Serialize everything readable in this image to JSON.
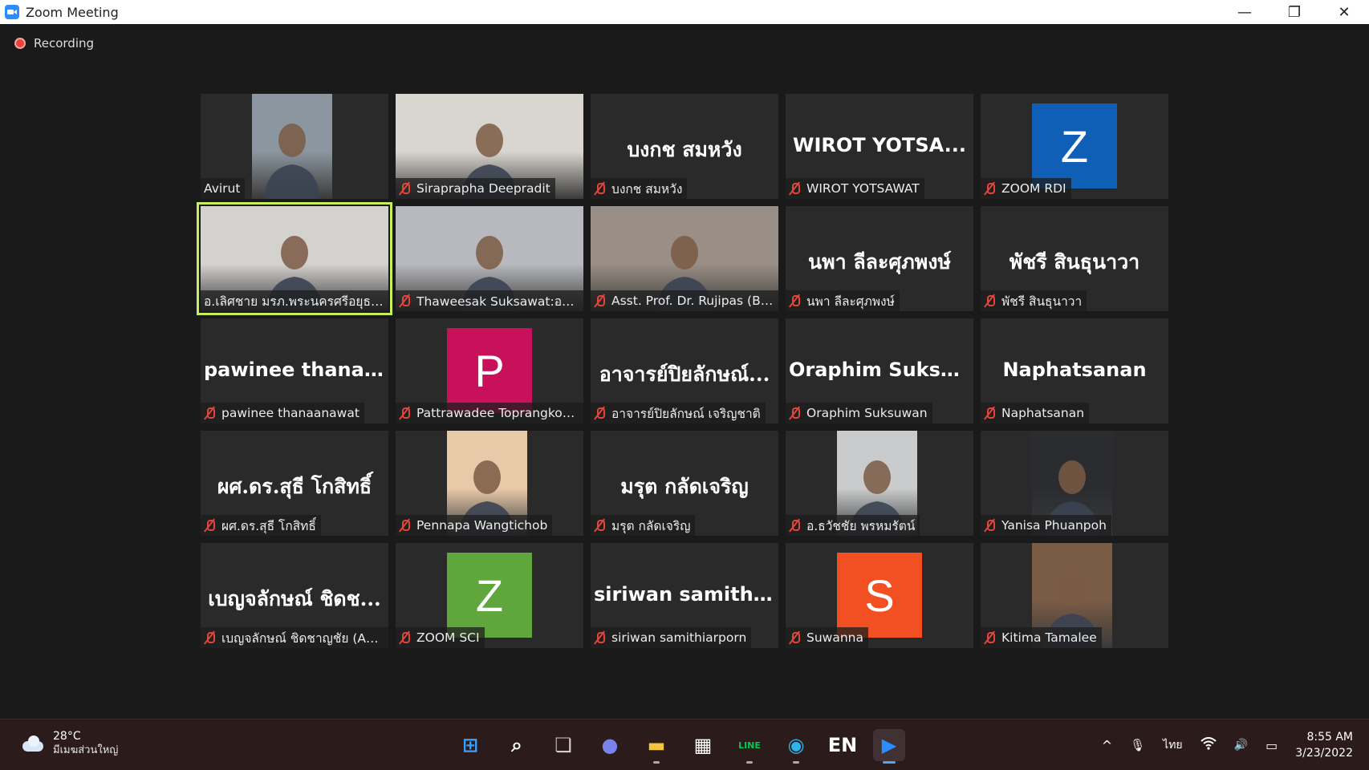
{
  "window": {
    "title": "Zoom Meeting",
    "minimize": "—",
    "restore": "❐",
    "close": "✕"
  },
  "meeting": {
    "recording_label": "Recording"
  },
  "participants": [
    {
      "row": 0,
      "col": 0,
      "label": "Avirut",
      "muted": false,
      "kind": "video",
      "bg": "#8c96a0"
    },
    {
      "row": 0,
      "col": 1,
      "label": "Siraprapha Deepradit",
      "muted": true,
      "kind": "video-wide",
      "bg": "#d9d6cf"
    },
    {
      "row": 0,
      "col": 2,
      "label": "บงกช สมหวัง",
      "display": "บงกช สมหวัง",
      "muted": true,
      "kind": "name"
    },
    {
      "row": 0,
      "col": 3,
      "label": "WIROT YOTSAWAT",
      "display": "WIROT  YOTSA...",
      "muted": true,
      "kind": "name",
      "latin": true
    },
    {
      "row": 0,
      "col": 4,
      "label": "ZOOM RDI",
      "avatar_letter": "Z",
      "avatar_color": "#0e5fb5",
      "muted": true,
      "kind": "avatar"
    },
    {
      "row": 1,
      "col": 0,
      "label": "อ.เลิศชาย มรภ.พระนครศรีอยุธยา",
      "muted": false,
      "kind": "video-wide",
      "bg": "#d4d2cf",
      "active": true
    },
    {
      "row": 1,
      "col": 1,
      "label": "Thaweesak Suksawat:อนุฯ ...",
      "muted": true,
      "kind": "video-wide",
      "bg": "#b8b9be"
    },
    {
      "row": 1,
      "col": 2,
      "label": "Asst. Prof. Dr. Rujipas (Bai...",
      "muted": true,
      "kind": "video-wide",
      "bg": "#9a8f86"
    },
    {
      "row": 1,
      "col": 3,
      "label": "นพา  ลีละศุภพงษ์",
      "display": "นพา  ลีละศุภพงษ์",
      "muted": true,
      "kind": "name"
    },
    {
      "row": 1,
      "col": 4,
      "label": "พัชรี สินธุนาวา",
      "display": "พัชรี สินธุนาวา",
      "muted": true,
      "kind": "name"
    },
    {
      "row": 2,
      "col": 0,
      "label": "pawinee thanaanawat",
      "display": "pawinee  thanaa...",
      "muted": true,
      "kind": "name",
      "latin": true
    },
    {
      "row": 2,
      "col": 1,
      "label": "Pattrawadee Toprangkob...",
      "avatar_letter": "P",
      "avatar_color": "#c8115a",
      "muted": true,
      "kind": "avatar"
    },
    {
      "row": 2,
      "col": 2,
      "label": "อาจารย์ปิยลักษณ์ เจริญชาติ",
      "display": "อาจารย์ปิยลักษณ์...",
      "muted": true,
      "kind": "name"
    },
    {
      "row": 2,
      "col": 3,
      "label": "Oraphim Suksuwan",
      "display": "Oraphim  Suksu...",
      "muted": true,
      "kind": "name",
      "latin": true
    },
    {
      "row": 2,
      "col": 4,
      "label": "Naphatsanan",
      "display": "Naphatsanan",
      "muted": true,
      "kind": "name",
      "latin": true
    },
    {
      "row": 3,
      "col": 0,
      "label": "ผศ.ดร.สุธี โกสิทธิ์",
      "display": "ผศ.ดร.สุธี โกสิทธิ์",
      "muted": true,
      "kind": "name"
    },
    {
      "row": 3,
      "col": 1,
      "label": "Pennapa Wangtichob",
      "muted": true,
      "kind": "photo",
      "bg": "#e8c9a8"
    },
    {
      "row": 3,
      "col": 2,
      "label": "มรุต  กลัดเจริญ",
      "display": "มรุต  กลัดเจริญ",
      "muted": true,
      "kind": "name"
    },
    {
      "row": 3,
      "col": 3,
      "label": "อ.ธวัชชัย พรหมรัตน์",
      "muted": true,
      "kind": "photo",
      "bg": "#c9cbcc"
    },
    {
      "row": 3,
      "col": 4,
      "label": "Yanisa Phuanpoh",
      "muted": true,
      "kind": "photo",
      "bg": "#2a2c30"
    },
    {
      "row": 4,
      "col": 0,
      "label": "เบญจลักษณ์ ชิดชาญชัย (AR...",
      "display": "เบญจลักษณ์ ชิดช...",
      "muted": true,
      "kind": "name"
    },
    {
      "row": 4,
      "col": 1,
      "label": "ZOOM SCI",
      "avatar_letter": "Z",
      "avatar_color": "#5fa63c",
      "muted": true,
      "kind": "avatar"
    },
    {
      "row": 4,
      "col": 2,
      "label": "siriwan samithiarporn",
      "display": "siriwan  samithi...",
      "muted": true,
      "kind": "name",
      "latin": true
    },
    {
      "row": 4,
      "col": 3,
      "label": "Suwanna",
      "avatar_letter": "S",
      "avatar_color": "#f25022",
      "muted": true,
      "kind": "avatar"
    },
    {
      "row": 4,
      "col": 4,
      "label": "Kitima Tamalee",
      "muted": true,
      "kind": "photo",
      "bg": "#7a5b44"
    }
  ],
  "taskbar": {
    "weather_temp": "28°C",
    "weather_desc": "มีเมฆส่วนใหญ่",
    "apps": [
      {
        "name": "start-button",
        "glyph": "⊞",
        "color": "#3aa0ff"
      },
      {
        "name": "search-button",
        "glyph": "⌕",
        "color": "#ffffff"
      },
      {
        "name": "task-view-button",
        "glyph": "❏",
        "color": "#cfcfcf"
      },
      {
        "name": "chat-app",
        "glyph": "●",
        "color": "#7b83eb"
      },
      {
        "name": "file-explorer-app",
        "glyph": "▬",
        "color": "#f4c542",
        "open": true
      },
      {
        "name": "microsoft-store-app",
        "glyph": "▦",
        "color": "#ffffff"
      },
      {
        "name": "line-app",
        "glyph": "LINE",
        "color": "#06c755",
        "open": true
      },
      {
        "name": "edge-app",
        "glyph": "◉",
        "color": "#2fb4e9",
        "open": true
      },
      {
        "name": "en-dictionary-app",
        "glyph": "EN",
        "color": "#ffffff"
      },
      {
        "name": "zoom-app",
        "glyph": "▶",
        "color": "#2d8cff",
        "active": true
      }
    ],
    "chevron": "^",
    "mic": "🎙",
    "language": "ไทย",
    "wifi": "wifi",
    "volume": "🔊",
    "battery": "▭",
    "time": "8:55 AM",
    "date": "3/23/2022"
  }
}
